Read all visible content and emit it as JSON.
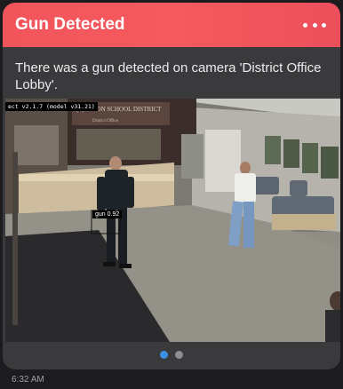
{
  "notification": {
    "title": "Gun Detected",
    "more_icon": "ellipsis-icon",
    "message": "There was a gun detected on camera 'District Office Lobby'.",
    "accent_color": "#f2545b"
  },
  "camera": {
    "name": "District Office Lobby",
    "model_label": "ect v2.1.7 (model v31.21)",
    "detection_label": "gun 0.92",
    "sign_text": "[?]-UNION SCHOOL DISTRICT",
    "sign_subtext": "District Office"
  },
  "pager": {
    "page_count": 2,
    "active_index": 0,
    "active_color": "#3d8fe6"
  },
  "timestamp": "6:32 AM"
}
